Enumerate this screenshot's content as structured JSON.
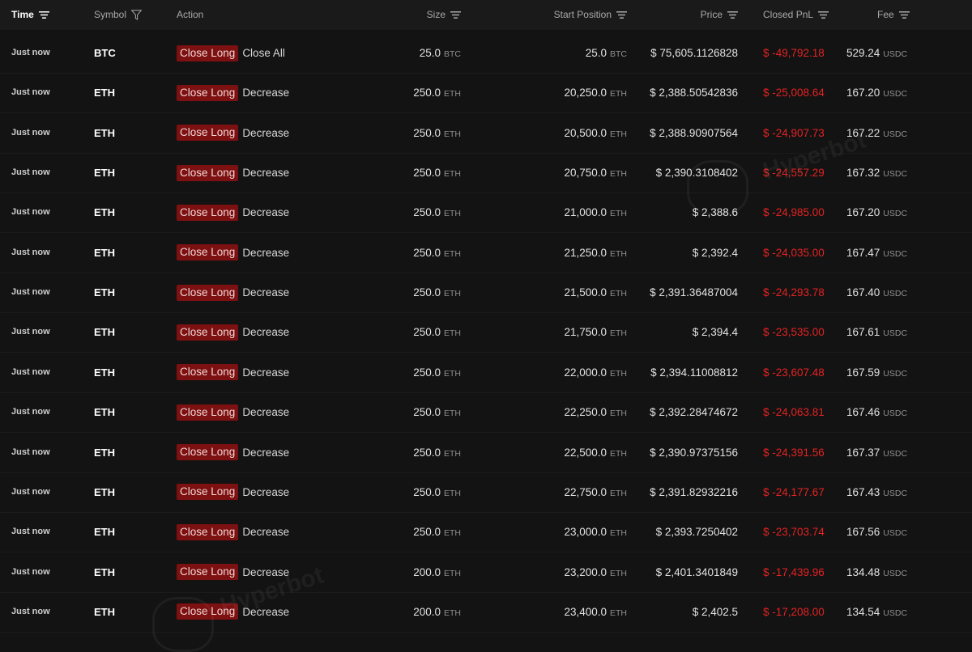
{
  "header": {
    "time": "Time",
    "symbol": "Symbol",
    "action": "Action",
    "size": "Size",
    "start_position": "Start Position",
    "price": "Price",
    "closed_pnl": "Closed PnL",
    "fee": "Fee"
  },
  "watermark": "Hyperbot",
  "rows": [
    {
      "time": "Just now",
      "symbol": "BTC",
      "badge": "Close Long",
      "action": "Close All",
      "size": "25.0",
      "size_unit": "BTC",
      "start": "25.0",
      "start_unit": "BTC",
      "price": "$ 75,605.1126828",
      "pnl": "$ -49,792.18",
      "fee": "529.24",
      "fee_unit": "USDC"
    },
    {
      "time": "Just now",
      "symbol": "ETH",
      "badge": "Close Long",
      "action": "Decrease",
      "size": "250.0",
      "size_unit": "ETH",
      "start": "20,250.0",
      "start_unit": "ETH",
      "price": "$ 2,388.50542836",
      "pnl": "$ -25,008.64",
      "fee": "167.20",
      "fee_unit": "USDC"
    },
    {
      "time": "Just now",
      "symbol": "ETH",
      "badge": "Close Long",
      "action": "Decrease",
      "size": "250.0",
      "size_unit": "ETH",
      "start": "20,500.0",
      "start_unit": "ETH",
      "price": "$ 2,388.90907564",
      "pnl": "$ -24,907.73",
      "fee": "167.22",
      "fee_unit": "USDC"
    },
    {
      "time": "Just now",
      "symbol": "ETH",
      "badge": "Close Long",
      "action": "Decrease",
      "size": "250.0",
      "size_unit": "ETH",
      "start": "20,750.0",
      "start_unit": "ETH",
      "price": "$ 2,390.3108402",
      "pnl": "$ -24,557.29",
      "fee": "167.32",
      "fee_unit": "USDC"
    },
    {
      "time": "Just now",
      "symbol": "ETH",
      "badge": "Close Long",
      "action": "Decrease",
      "size": "250.0",
      "size_unit": "ETH",
      "start": "21,000.0",
      "start_unit": "ETH",
      "price": "$ 2,388.6",
      "pnl": "$ -24,985.00",
      "fee": "167.20",
      "fee_unit": "USDC"
    },
    {
      "time": "Just now",
      "symbol": "ETH",
      "badge": "Close Long",
      "action": "Decrease",
      "size": "250.0",
      "size_unit": "ETH",
      "start": "21,250.0",
      "start_unit": "ETH",
      "price": "$ 2,392.4",
      "pnl": "$ -24,035.00",
      "fee": "167.47",
      "fee_unit": "USDC"
    },
    {
      "time": "Just now",
      "symbol": "ETH",
      "badge": "Close Long",
      "action": "Decrease",
      "size": "250.0",
      "size_unit": "ETH",
      "start": "21,500.0",
      "start_unit": "ETH",
      "price": "$ 2,391.36487004",
      "pnl": "$ -24,293.78",
      "fee": "167.40",
      "fee_unit": "USDC"
    },
    {
      "time": "Just now",
      "symbol": "ETH",
      "badge": "Close Long",
      "action": "Decrease",
      "size": "250.0",
      "size_unit": "ETH",
      "start": "21,750.0",
      "start_unit": "ETH",
      "price": "$ 2,394.4",
      "pnl": "$ -23,535.00",
      "fee": "167.61",
      "fee_unit": "USDC"
    },
    {
      "time": "Just now",
      "symbol": "ETH",
      "badge": "Close Long",
      "action": "Decrease",
      "size": "250.0",
      "size_unit": "ETH",
      "start": "22,000.0",
      "start_unit": "ETH",
      "price": "$ 2,394.11008812",
      "pnl": "$ -23,607.48",
      "fee": "167.59",
      "fee_unit": "USDC"
    },
    {
      "time": "Just now",
      "symbol": "ETH",
      "badge": "Close Long",
      "action": "Decrease",
      "size": "250.0",
      "size_unit": "ETH",
      "start": "22,250.0",
      "start_unit": "ETH",
      "price": "$ 2,392.28474672",
      "pnl": "$ -24,063.81",
      "fee": "167.46",
      "fee_unit": "USDC"
    },
    {
      "time": "Just now",
      "symbol": "ETH",
      "badge": "Close Long",
      "action": "Decrease",
      "size": "250.0",
      "size_unit": "ETH",
      "start": "22,500.0",
      "start_unit": "ETH",
      "price": "$ 2,390.97375156",
      "pnl": "$ -24,391.56",
      "fee": "167.37",
      "fee_unit": "USDC"
    },
    {
      "time": "Just now",
      "symbol": "ETH",
      "badge": "Close Long",
      "action": "Decrease",
      "size": "250.0",
      "size_unit": "ETH",
      "start": "22,750.0",
      "start_unit": "ETH",
      "price": "$ 2,391.82932216",
      "pnl": "$ -24,177.67",
      "fee": "167.43",
      "fee_unit": "USDC"
    },
    {
      "time": "Just now",
      "symbol": "ETH",
      "badge": "Close Long",
      "action": "Decrease",
      "size": "250.0",
      "size_unit": "ETH",
      "start": "23,000.0",
      "start_unit": "ETH",
      "price": "$ 2,393.7250402",
      "pnl": "$ -23,703.74",
      "fee": "167.56",
      "fee_unit": "USDC"
    },
    {
      "time": "Just now",
      "symbol": "ETH",
      "badge": "Close Long",
      "action": "Decrease",
      "size": "200.0",
      "size_unit": "ETH",
      "start": "23,200.0",
      "start_unit": "ETH",
      "price": "$ 2,401.3401849",
      "pnl": "$ -17,439.96",
      "fee": "134.48",
      "fee_unit": "USDC"
    },
    {
      "time": "Just now",
      "symbol": "ETH",
      "badge": "Close Long",
      "action": "Decrease",
      "size": "200.0",
      "size_unit": "ETH",
      "start": "23,400.0",
      "start_unit": "ETH",
      "price": "$ 2,402.5",
      "pnl": "$ -17,208.00",
      "fee": "134.54",
      "fee_unit": "USDC"
    }
  ]
}
